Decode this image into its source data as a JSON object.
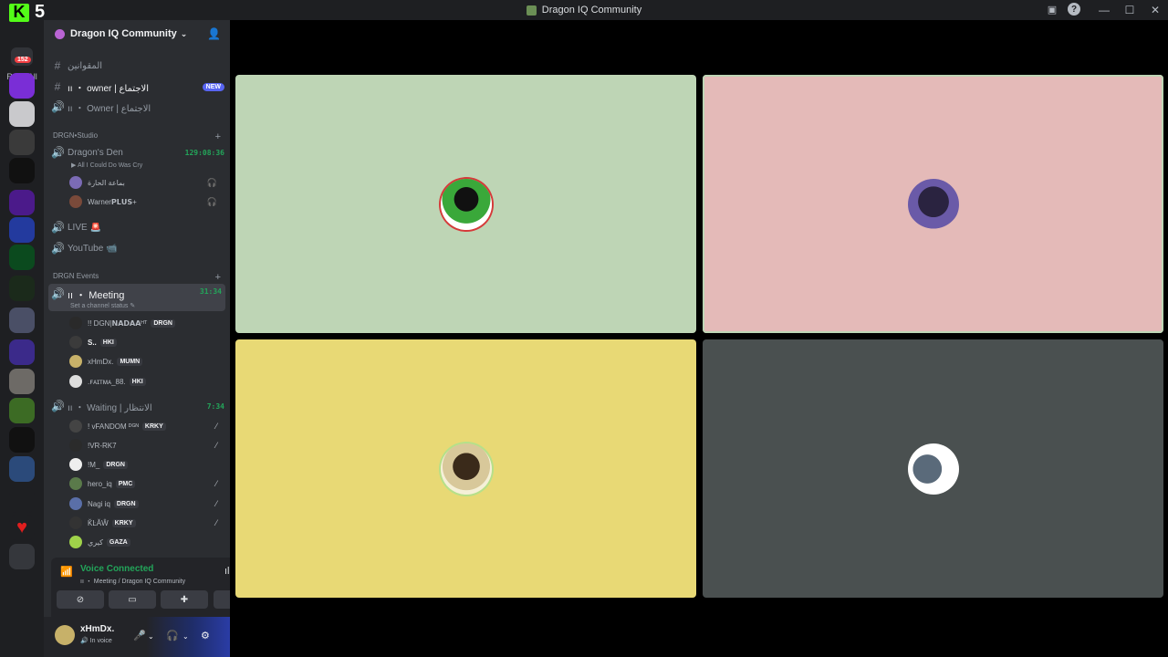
{
  "window": {
    "title": "Dragon IQ Community",
    "overlay_number": "5"
  },
  "guild_bar": {
    "unread_badge": "152",
    "read_all_label": "Read All"
  },
  "server": {
    "name": "Dragon IQ Community"
  },
  "channels": {
    "top": [
      {
        "name": "المقوانين",
        "type": "text"
      },
      {
        "name": "ıı ・ owner | الاجتماع",
        "type": "text",
        "badge": "NEW"
      },
      {
        "name": "ıı ・ Owner | الاجتماع",
        "type": "voice"
      }
    ],
    "studio_category": "DRGN•Studio",
    "studio": [
      {
        "name": "Dragon's Den",
        "timer": "129:08:36",
        "activity": "All I Could Do Was Cry"
      },
      {
        "name": "LIVE 🚨"
      },
      {
        "name": "YouTube 📹"
      }
    ],
    "studio_members": [
      {
        "name": "بماعة الحارة"
      },
      {
        "name": "Warner𝗣𝗟𝗨𝗦+"
      }
    ],
    "events_category": "DRGN Events",
    "meeting": {
      "name": "ıı ・ Meeting",
      "timer": "31:34",
      "status_placeholder": "Set a channel status"
    },
    "meeting_members": [
      {
        "name": "!! DGN|𝗡𝗔𝗗𝗔𝗔ᴴᵀ",
        "tag": "DRGN"
      },
      {
        "name": "S..",
        "tag": "HKI"
      },
      {
        "name": "xHmDx.",
        "tag": "MUMN"
      },
      {
        "name": ".ꜰᴀɪᴛᴍᴀ_88.",
        "tag": "HKI"
      }
    ],
    "waiting": {
      "name": "ıı ・ Waiting | الانتظار",
      "timer": "7:34"
    },
    "waiting_members": [
      {
        "name": "! vFANDOM ᴰᴳᴺ",
        "tag": "KRKY"
      },
      {
        "name": "!VR-RK7",
        "tag": ""
      },
      {
        "name": "!M_",
        "tag": "DRGN"
      },
      {
        "name": "hero_iq",
        "tag": "PMC"
      },
      {
        "name": "Nagi iq",
        "tag": "DRGN"
      },
      {
        "name": "ǨĿǍŴ",
        "tag": "KRKY"
      },
      {
        "name": "كيري",
        "tag": "GAZA"
      }
    ]
  },
  "voice_panel": {
    "status": "Voice Connected",
    "channel": "ıı ・ Meeting / Dragon IQ Community"
  },
  "user": {
    "name": "xHmDx.",
    "status": "In voice"
  },
  "colors": {
    "tile1": "#bed5b5",
    "tile2": "#e4bab8",
    "tile3": "#e8d975",
    "tile4": "#4a5050",
    "voice_green": "#23a55a"
  }
}
